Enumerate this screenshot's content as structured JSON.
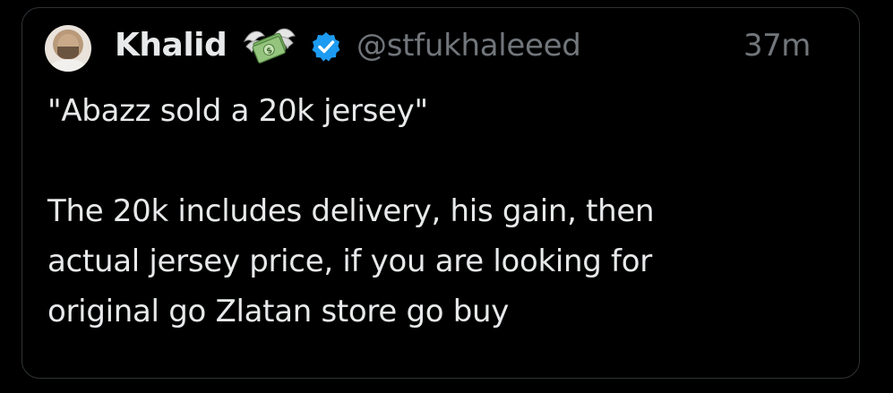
{
  "tweet": {
    "author": {
      "name": "Khalid",
      "handle": "@stfukhaleeed",
      "verified": true,
      "name_emoji": "money-with-wings-icon"
    },
    "timestamp": "37m",
    "text_line1": "\"Abazz sold a 20k jersey\"",
    "text_body": "The 20k includes delivery, his gain, then\nactual jersey price, if you are looking for\noriginal go Zlatan store go buy"
  },
  "colors": {
    "background": "#000000",
    "text": "#e7e9ea",
    "secondary": "#71767b",
    "verified_blue": "#1d9bf0",
    "border": "#2f3336"
  }
}
